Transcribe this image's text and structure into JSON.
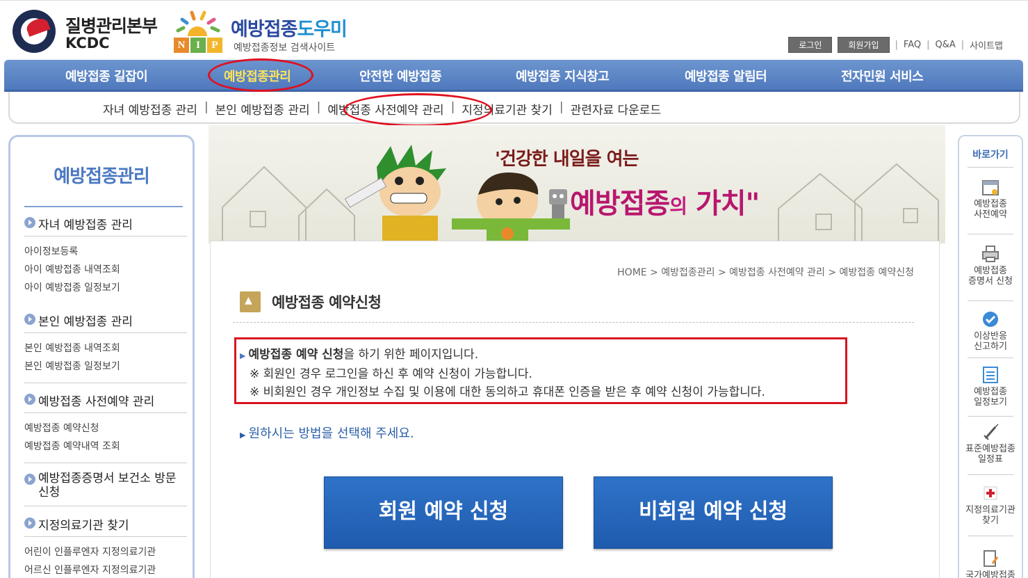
{
  "header": {
    "org_name": "질병관리본부",
    "org_en": "KCDC",
    "site_title_main": "예방접종",
    "site_title_sub": "도우미",
    "nip_letters": [
      "N",
      "I",
      "P"
    ],
    "site_subtitle": "예방접종정보 검색사이트",
    "login_label": "로그인",
    "join_label": "회원가입",
    "links": [
      "FAQ",
      "Q&A",
      "사이트맵"
    ]
  },
  "gnb": {
    "items": [
      "예방접종 길잡이",
      "예방접종관리",
      "안전한 예방접종",
      "예방접종 지식창고",
      "예방접종 알림터",
      "전자민원 서비스"
    ],
    "active_index": 1
  },
  "subnav": {
    "items": [
      "자녀 예방접종 관리",
      "본인 예방접종 관리",
      "예방접종 사전예약 관리",
      "지정의료기관 찾기",
      "관련자료 다운로드"
    ]
  },
  "sidebar": {
    "title": "예방접종관리",
    "sections": [
      {
        "label": "자녀 예방접종 관리",
        "links": [
          "아이정보등록",
          "아이 예방접종 내역조회",
          "아이 예방접종 일정보기"
        ]
      },
      {
        "label": "본인 예방접종 관리",
        "links": [
          "본인 예방접종 내역조회",
          "본인 예방접종 일정보기"
        ]
      },
      {
        "label": "예방접종 사전예약 관리",
        "links": [
          "예방접종 예약신청",
          "예방접종 예약내역 조회"
        ]
      },
      {
        "label": "예방접종증명서 보건소 방문신청",
        "links": []
      },
      {
        "label": "지정의료기관 찾기",
        "links": [
          "어린이 인플루엔자 지정의료기관",
          "어르신 인플루엔자 지정의료기관"
        ]
      }
    ]
  },
  "banner": {
    "slogan_line1": "'건강한 내일을 여는",
    "slogan_main": "예방접종",
    "slogan_particle": "의",
    "slogan_end": "가치\""
  },
  "content": {
    "breadcrumb": "HOME > 예방접종관리 > 예방접종 사전예약 관리 > 예방접종 예약신청",
    "title": "예방접종 예약신청",
    "info_bold": "예방접종 예약 신청",
    "info_rest": "을 하기 위한 페이지입니다.",
    "note1": "※ 회원인 경우 로그인을 하신 후 예약 신청이 가능합니다.",
    "note2": "※ 비회원인 경우 개인정보 수집 및 이용에 대한 동의하고 휴대폰 인증을 받은 후 예약 신청이 가능합니다.",
    "choose": "원하시는 방법을 선택해 주세요.",
    "member_button": "회원 예약 신청",
    "nonmember_button": "비회원 예약 신청"
  },
  "quick": {
    "title": "바로가기",
    "items": [
      {
        "label1": "예방접종",
        "label2": "사전예약",
        "icon": "calendar-icon"
      },
      {
        "label1": "예방접종",
        "label2": "증명서 신청",
        "icon": "printer-icon"
      },
      {
        "label1": "이상반응",
        "label2": "신고하기",
        "icon": "check-circle-icon"
      },
      {
        "label1": "예방접종",
        "label2": "일정보기",
        "icon": "list-icon"
      },
      {
        "label1": "표준예방접종",
        "label2": "일정표",
        "icon": "syringe-icon"
      },
      {
        "label1": "지정의료기관",
        "label2": "찾기",
        "icon": "hospital-icon"
      },
      {
        "label1": "국가예방접종",
        "label2": "",
        "icon": "document-icon"
      }
    ]
  },
  "colors": {
    "gnb_blue": "#5a83c6",
    "active_yellow": "#ffe45c",
    "button_blue": "#2567bd",
    "annotation_red": "#e0101e"
  }
}
